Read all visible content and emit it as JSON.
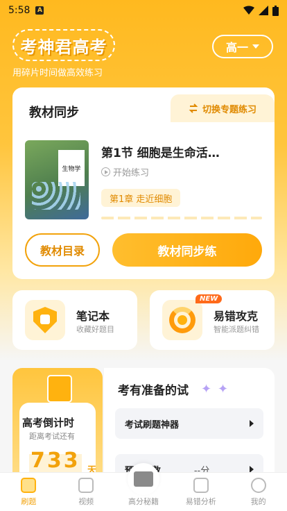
{
  "status": {
    "time": "5:58",
    "notif_icon": "A"
  },
  "header": {
    "logo": "考神君高考",
    "slogan": "用碎片时间做高效练习",
    "grade": "高一"
  },
  "textbook": {
    "title": "教材同步",
    "switch_label": "切换专题练习",
    "book_label": "生物学",
    "lesson_title": "第1节 细胞是生命活…",
    "start_label": "开始练习",
    "chapter": "第1章 走近细胞",
    "catalog_button": "教材目录",
    "sync_button": "教材同步练"
  },
  "tools": [
    {
      "name": "笔记本",
      "sub": "收藏好题目"
    },
    {
      "name": "易错攻克",
      "sub": "智能派题纠错",
      "badge": "NEW"
    }
  ],
  "countdown": {
    "title": "高考倒计时",
    "sub": "距离考试还有",
    "days": "733",
    "unit": "天"
  },
  "prep": {
    "title": "考有准备的试",
    "items": [
      {
        "label": "考试刷题神器"
      },
      {
        "label": "预估分数",
        "score": "--分"
      }
    ]
  },
  "tabbar": [
    {
      "label": "刷题",
      "icon": "printer-icon",
      "active": true
    },
    {
      "label": "视频",
      "icon": "video-icon"
    },
    {
      "label": "高分秘籍",
      "icon": "book-icon"
    },
    {
      "label": "易错分析",
      "icon": "chart-icon"
    },
    {
      "label": "我的",
      "icon": "user-icon"
    }
  ],
  "colors": {
    "accent": "#ffb20f",
    "accent_text": "#e08a00"
  }
}
